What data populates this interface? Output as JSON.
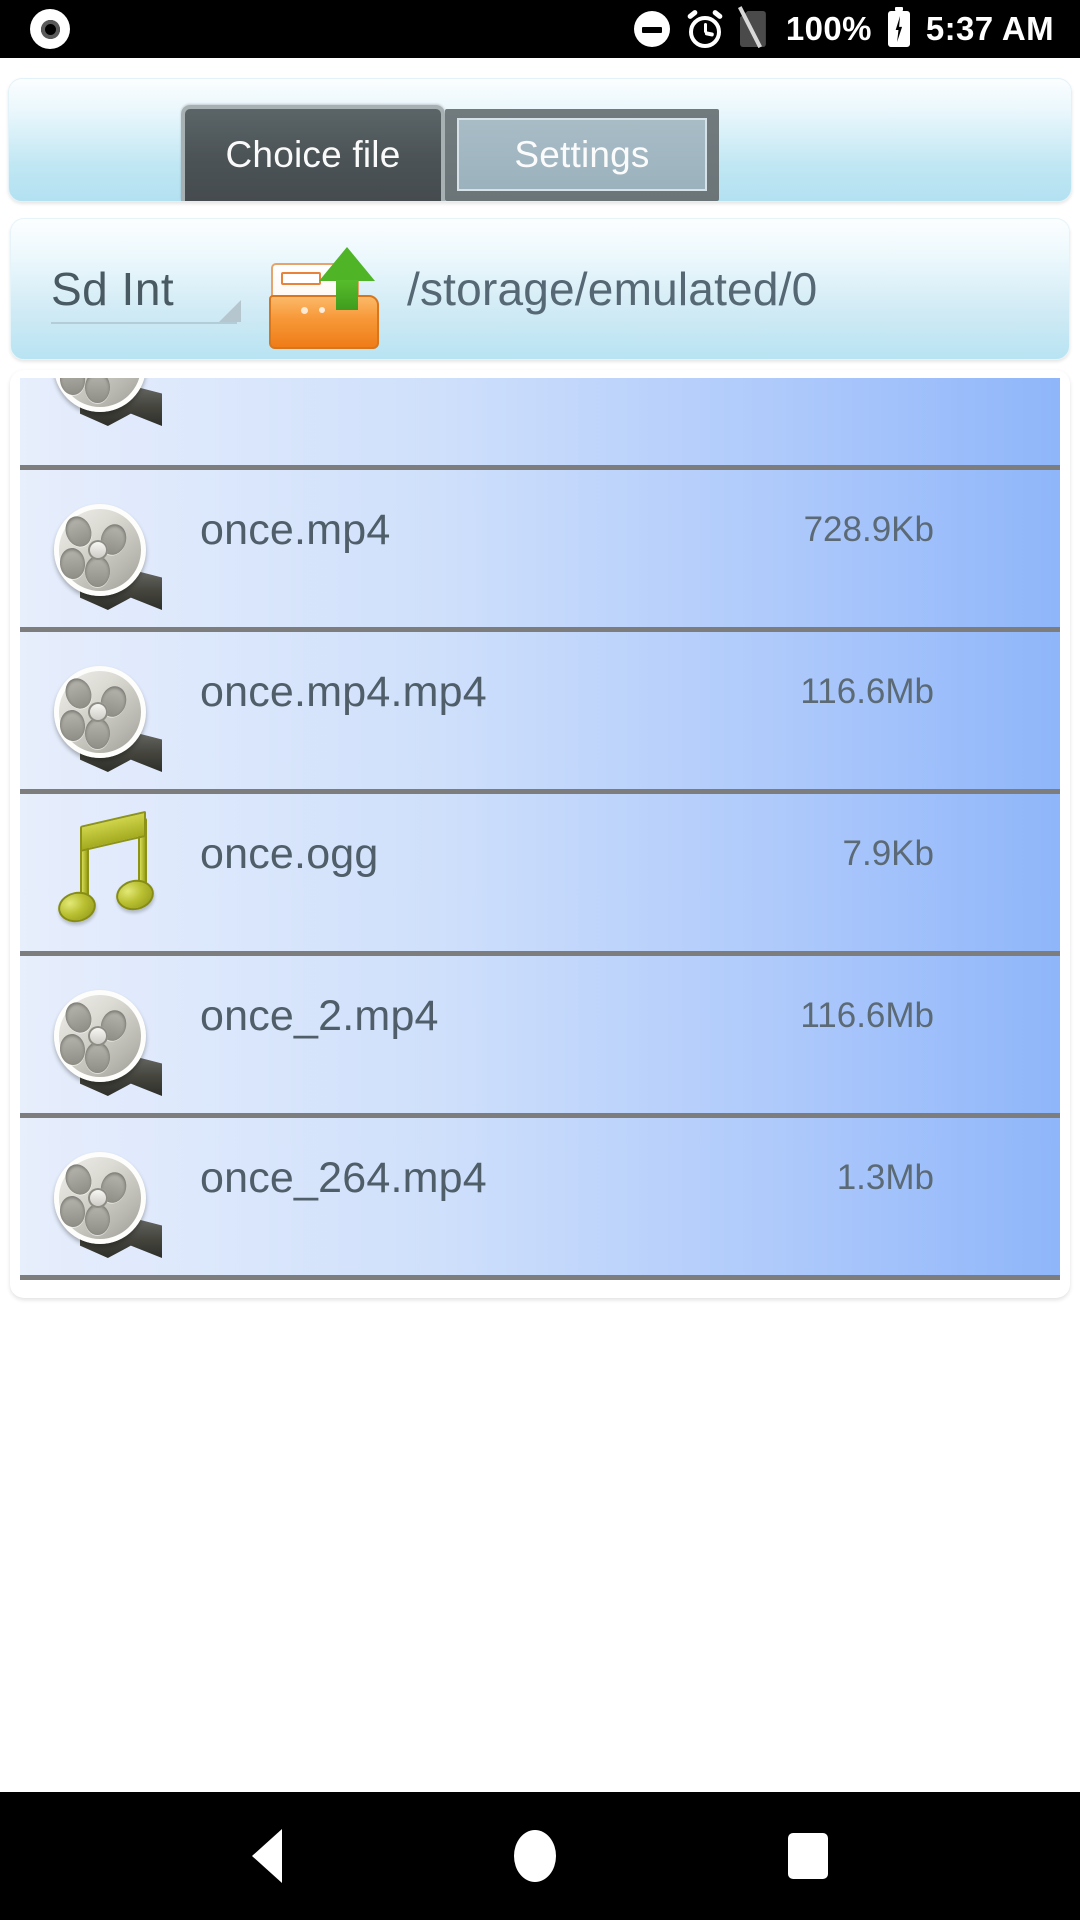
{
  "status_bar": {
    "record_icon": "record-icon",
    "dnd_icon": "do-not-disturb-icon",
    "alarm_icon": "alarm-icon",
    "no_sim_icon": "no-sim-card-icon",
    "battery_percent": "100%",
    "battery_icon": "battery-charging-icon",
    "time": "5:37 AM"
  },
  "tabs": [
    {
      "label": "Choice file",
      "selected": true
    },
    {
      "label": "Settings",
      "selected": false
    }
  ],
  "path_bar": {
    "storage_label": "Sd Int",
    "storage_caret_icon": "spinner-caret-icon",
    "folder_up_icon": "folder-up-icon",
    "path": "/storage/emulated/0"
  },
  "file_list": {
    "partial_top_row": {
      "icon": "film-reel-icon"
    },
    "rows": [
      {
        "icon": "film-reel-icon",
        "name": "once.mp4",
        "size": "728.9Kb"
      },
      {
        "icon": "film-reel-icon",
        "name": "once.mp4.mp4",
        "size": "116.6Mb"
      },
      {
        "icon": "music-note-icon",
        "name": "once.ogg",
        "size": "7.9Kb"
      },
      {
        "icon": "film-reel-icon",
        "name": "once_2.mp4",
        "size": "116.6Mb"
      },
      {
        "icon": "film-reel-icon",
        "name": "once_264.mp4",
        "size": "1.3Mb"
      }
    ]
  },
  "nav_bar": {
    "back_icon": "back-triangle-icon",
    "home_icon": "home-circle-icon",
    "recents_icon": "recents-square-icon"
  },
  "colors": {
    "status_bar_bg": "#000000",
    "panel_top": "#fbfeff",
    "panel_bottom": "#b3e1f1",
    "row_left": "#e7eefc",
    "row_right": "#8fb6fa",
    "divider": "#7d7d7d",
    "text_primary": "#4f5e68",
    "tab_selected_bg": "#4c5457",
    "tab_unselected_bg": "#a8bcc6",
    "folder_orange": "#f79939",
    "arrow_green": "#4fb527",
    "note_olive": "#a4ab1f"
  }
}
